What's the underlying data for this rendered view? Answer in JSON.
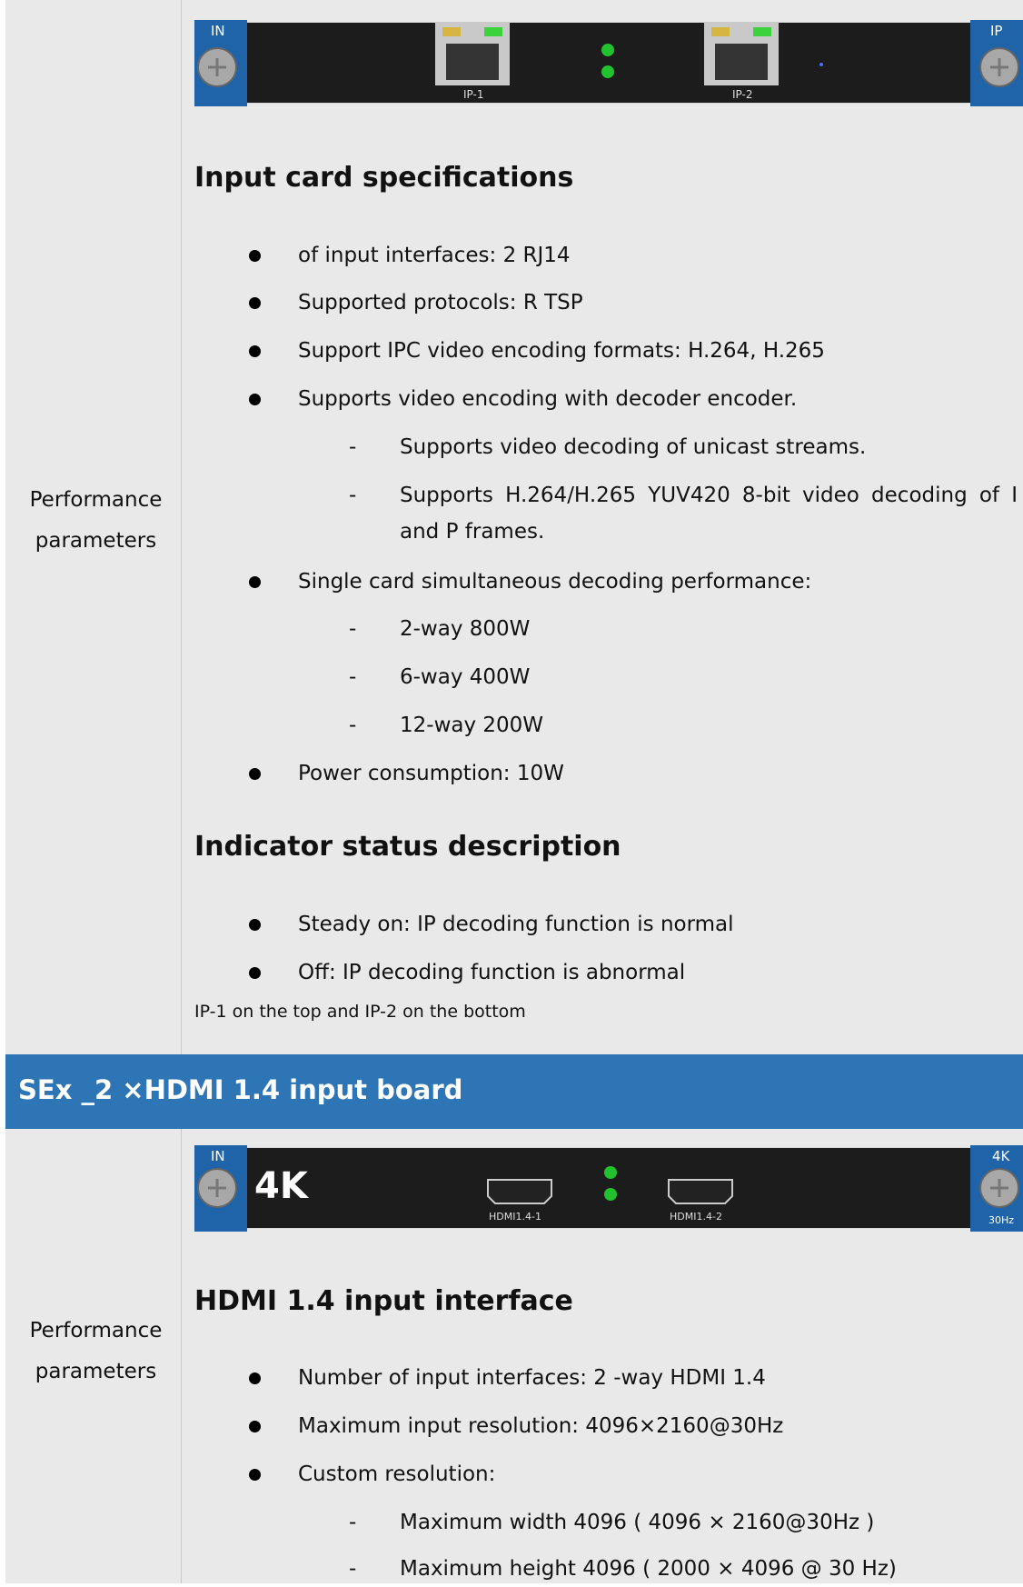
{
  "section1": {
    "row_label_line1": "Performance",
    "row_label_line2": "parameters",
    "card": {
      "left_tag": "IN",
      "right_tag": "IP",
      "port1_label": "IP-1",
      "port2_label": "IP-2",
      "led_color": "#22c22e"
    },
    "heading1": "Input card specifications",
    "items": [
      "of input interfaces: 2 RJ14",
      "Supported protocols: R TSP",
      "Support IPC video encoding formats: H.264, H.265",
      "Supports video encoding with decoder encoder."
    ],
    "sub_items_a": [
      "Supports video decoding of unicast streams.",
      "Supports H.264/H.265 YUV420 8-bit video decoding of I and P frames."
    ],
    "item_perf": "Single card simultaneous decoding performance:",
    "sub_items_b": [
      "2-way 800W",
      "6-way 400W",
      "12-way 200W"
    ],
    "item_power": "Power consumption: 10W",
    "heading2": "Indicator status description",
    "indicator_items": [
      "Steady on: IP decoding function is normal",
      "Off: IP decoding function is abnormal"
    ],
    "note": "IP-1 on the top and IP-2 on the bottom"
  },
  "section_bar": {
    "title": "SEx _2  ×HDMI 1.4 input board",
    "color": "#2e75b6"
  },
  "section2": {
    "row_label_line1": "Performance",
    "row_label_line2": "parameters",
    "card": {
      "left_tag": "IN",
      "big_label": "4K",
      "port1_label": "HDMI1.4-1",
      "port2_label": "HDMI1.4-2",
      "right_tag": "4K",
      "right_sub": "30Hz",
      "led_color": "#22c22e"
    },
    "heading": "HDMI 1.4 input interface",
    "items": [
      "Number of input interfaces: 2 -way HDMI 1.4",
      "Maximum input resolution: 4096×2160@30Hz",
      "Custom resolution:"
    ],
    "sub_items": [
      "Maximum width 4096 ( 4096  ×  2160@30Hz )",
      "Maximum height 4096 ( 2000  ×  4096 @ 30 Hz)"
    ]
  }
}
